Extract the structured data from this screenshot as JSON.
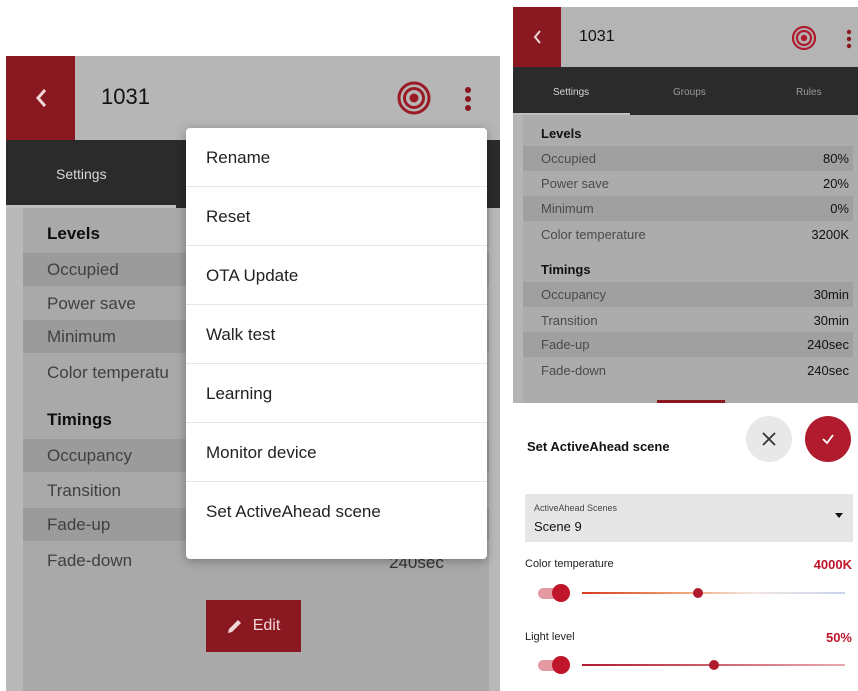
{
  "left": {
    "title": "1031",
    "tab_settings": "Settings",
    "levels_heading": "Levels",
    "levels": [
      "Occupied",
      "Power save",
      "Minimum",
      "Color temperatu"
    ],
    "timings_heading": "Timings",
    "timings": [
      "Occupancy",
      "Transition",
      "Fade-up",
      "Fade-down"
    ],
    "fade_down_value": "240sec",
    "edit_label": "Edit",
    "menu": [
      "Rename",
      "Reset",
      "OTA Update",
      "Walk test",
      "Learning",
      "Monitor device",
      "Set ActiveAhead scene"
    ]
  },
  "right": {
    "title": "1031",
    "tabs": [
      "Settings",
      "Groups",
      "Rules"
    ],
    "levels_heading": "Levels",
    "levels": [
      {
        "label": "Occupied",
        "value": "80%"
      },
      {
        "label": "Power save",
        "value": "20%"
      },
      {
        "label": "Minimum",
        "value": "0%"
      },
      {
        "label": "Color temperature",
        "value": "3200K"
      }
    ],
    "timings_heading": "Timings",
    "timings": [
      {
        "label": "Occupancy",
        "value": "30min"
      },
      {
        "label": "Transition",
        "value": "30min"
      },
      {
        "label": "Fade-up",
        "value": "240sec"
      },
      {
        "label": "Fade-down",
        "value": "240sec"
      }
    ],
    "sheet": {
      "title": "Set ActiveAhead scene",
      "select_label": "ActiveAhead Scenes",
      "select_value": "Scene 9",
      "color_temp_label": "Color temperature",
      "color_temp_value": "4000K",
      "color_temp_fraction": 0.44,
      "light_level_label": "Light level",
      "light_level_value": "50%",
      "light_level_fraction": 0.5
    }
  },
  "colors": {
    "brand_red": "#8a1820",
    "accent_red": "#c0152a",
    "tab_bar": "#2b2b2b"
  }
}
